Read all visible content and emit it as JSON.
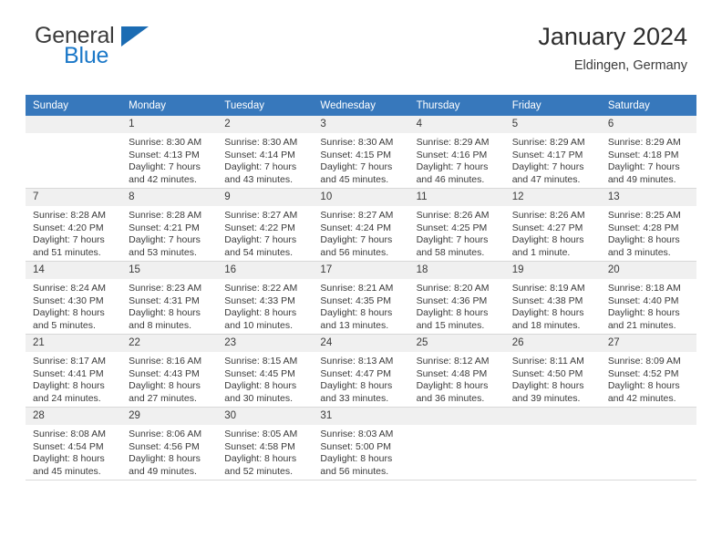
{
  "brand": {
    "name_part1": "General",
    "name_part2": "Blue"
  },
  "header": {
    "title": "January 2024",
    "subtitle": "Eldingen, Germany"
  },
  "colors": {
    "header_blue": "#3778bc",
    "logo_blue": "#1b78c8",
    "daynum_bg": "#f0f0f0",
    "grid_line": "#d8d8d8",
    "text": "#3a3a3a"
  },
  "weekdays": [
    "Sunday",
    "Monday",
    "Tuesday",
    "Wednesday",
    "Thursday",
    "Friday",
    "Saturday"
  ],
  "weeks": [
    [
      {
        "day": "",
        "empty": true,
        "sunrise": "",
        "sunset": "",
        "daylight1": "",
        "daylight2": ""
      },
      {
        "day": "1",
        "sunrise": "Sunrise: 8:30 AM",
        "sunset": "Sunset: 4:13 PM",
        "daylight1": "Daylight: 7 hours",
        "daylight2": "and 42 minutes."
      },
      {
        "day": "2",
        "sunrise": "Sunrise: 8:30 AM",
        "sunset": "Sunset: 4:14 PM",
        "daylight1": "Daylight: 7 hours",
        "daylight2": "and 43 minutes."
      },
      {
        "day": "3",
        "sunrise": "Sunrise: 8:30 AM",
        "sunset": "Sunset: 4:15 PM",
        "daylight1": "Daylight: 7 hours",
        "daylight2": "and 45 minutes."
      },
      {
        "day": "4",
        "sunrise": "Sunrise: 8:29 AM",
        "sunset": "Sunset: 4:16 PM",
        "daylight1": "Daylight: 7 hours",
        "daylight2": "and 46 minutes."
      },
      {
        "day": "5",
        "sunrise": "Sunrise: 8:29 AM",
        "sunset": "Sunset: 4:17 PM",
        "daylight1": "Daylight: 7 hours",
        "daylight2": "and 47 minutes."
      },
      {
        "day": "6",
        "sunrise": "Sunrise: 8:29 AM",
        "sunset": "Sunset: 4:18 PM",
        "daylight1": "Daylight: 7 hours",
        "daylight2": "and 49 minutes."
      }
    ],
    [
      {
        "day": "7",
        "sunrise": "Sunrise: 8:28 AM",
        "sunset": "Sunset: 4:20 PM",
        "daylight1": "Daylight: 7 hours",
        "daylight2": "and 51 minutes."
      },
      {
        "day": "8",
        "sunrise": "Sunrise: 8:28 AM",
        "sunset": "Sunset: 4:21 PM",
        "daylight1": "Daylight: 7 hours",
        "daylight2": "and 53 minutes."
      },
      {
        "day": "9",
        "sunrise": "Sunrise: 8:27 AM",
        "sunset": "Sunset: 4:22 PM",
        "daylight1": "Daylight: 7 hours",
        "daylight2": "and 54 minutes."
      },
      {
        "day": "10",
        "sunrise": "Sunrise: 8:27 AM",
        "sunset": "Sunset: 4:24 PM",
        "daylight1": "Daylight: 7 hours",
        "daylight2": "and 56 minutes."
      },
      {
        "day": "11",
        "sunrise": "Sunrise: 8:26 AM",
        "sunset": "Sunset: 4:25 PM",
        "daylight1": "Daylight: 7 hours",
        "daylight2": "and 58 minutes."
      },
      {
        "day": "12",
        "sunrise": "Sunrise: 8:26 AM",
        "sunset": "Sunset: 4:27 PM",
        "daylight1": "Daylight: 8 hours",
        "daylight2": "and 1 minute."
      },
      {
        "day": "13",
        "sunrise": "Sunrise: 8:25 AM",
        "sunset": "Sunset: 4:28 PM",
        "daylight1": "Daylight: 8 hours",
        "daylight2": "and 3 minutes."
      }
    ],
    [
      {
        "day": "14",
        "sunrise": "Sunrise: 8:24 AM",
        "sunset": "Sunset: 4:30 PM",
        "daylight1": "Daylight: 8 hours",
        "daylight2": "and 5 minutes."
      },
      {
        "day": "15",
        "sunrise": "Sunrise: 8:23 AM",
        "sunset": "Sunset: 4:31 PM",
        "daylight1": "Daylight: 8 hours",
        "daylight2": "and 8 minutes."
      },
      {
        "day": "16",
        "sunrise": "Sunrise: 8:22 AM",
        "sunset": "Sunset: 4:33 PM",
        "daylight1": "Daylight: 8 hours",
        "daylight2": "and 10 minutes."
      },
      {
        "day": "17",
        "sunrise": "Sunrise: 8:21 AM",
        "sunset": "Sunset: 4:35 PM",
        "daylight1": "Daylight: 8 hours",
        "daylight2": "and 13 minutes."
      },
      {
        "day": "18",
        "sunrise": "Sunrise: 8:20 AM",
        "sunset": "Sunset: 4:36 PM",
        "daylight1": "Daylight: 8 hours",
        "daylight2": "and 15 minutes."
      },
      {
        "day": "19",
        "sunrise": "Sunrise: 8:19 AM",
        "sunset": "Sunset: 4:38 PM",
        "daylight1": "Daylight: 8 hours",
        "daylight2": "and 18 minutes."
      },
      {
        "day": "20",
        "sunrise": "Sunrise: 8:18 AM",
        "sunset": "Sunset: 4:40 PM",
        "daylight1": "Daylight: 8 hours",
        "daylight2": "and 21 minutes."
      }
    ],
    [
      {
        "day": "21",
        "sunrise": "Sunrise: 8:17 AM",
        "sunset": "Sunset: 4:41 PM",
        "daylight1": "Daylight: 8 hours",
        "daylight2": "and 24 minutes."
      },
      {
        "day": "22",
        "sunrise": "Sunrise: 8:16 AM",
        "sunset": "Sunset: 4:43 PM",
        "daylight1": "Daylight: 8 hours",
        "daylight2": "and 27 minutes."
      },
      {
        "day": "23",
        "sunrise": "Sunrise: 8:15 AM",
        "sunset": "Sunset: 4:45 PM",
        "daylight1": "Daylight: 8 hours",
        "daylight2": "and 30 minutes."
      },
      {
        "day": "24",
        "sunrise": "Sunrise: 8:13 AM",
        "sunset": "Sunset: 4:47 PM",
        "daylight1": "Daylight: 8 hours",
        "daylight2": "and 33 minutes."
      },
      {
        "day": "25",
        "sunrise": "Sunrise: 8:12 AM",
        "sunset": "Sunset: 4:48 PM",
        "daylight1": "Daylight: 8 hours",
        "daylight2": "and 36 minutes."
      },
      {
        "day": "26",
        "sunrise": "Sunrise: 8:11 AM",
        "sunset": "Sunset: 4:50 PM",
        "daylight1": "Daylight: 8 hours",
        "daylight2": "and 39 minutes."
      },
      {
        "day": "27",
        "sunrise": "Sunrise: 8:09 AM",
        "sunset": "Sunset: 4:52 PM",
        "daylight1": "Daylight: 8 hours",
        "daylight2": "and 42 minutes."
      }
    ],
    [
      {
        "day": "28",
        "sunrise": "Sunrise: 8:08 AM",
        "sunset": "Sunset: 4:54 PM",
        "daylight1": "Daylight: 8 hours",
        "daylight2": "and 45 minutes."
      },
      {
        "day": "29",
        "sunrise": "Sunrise: 8:06 AM",
        "sunset": "Sunset: 4:56 PM",
        "daylight1": "Daylight: 8 hours",
        "daylight2": "and 49 minutes."
      },
      {
        "day": "30",
        "sunrise": "Sunrise: 8:05 AM",
        "sunset": "Sunset: 4:58 PM",
        "daylight1": "Daylight: 8 hours",
        "daylight2": "and 52 minutes."
      },
      {
        "day": "31",
        "sunrise": "Sunrise: 8:03 AM",
        "sunset": "Sunset: 5:00 PM",
        "daylight1": "Daylight: 8 hours",
        "daylight2": "and 56 minutes."
      },
      {
        "day": "",
        "empty": true,
        "sunrise": "",
        "sunset": "",
        "daylight1": "",
        "daylight2": ""
      },
      {
        "day": "",
        "empty": true,
        "sunrise": "",
        "sunset": "",
        "daylight1": "",
        "daylight2": ""
      },
      {
        "day": "",
        "empty": true,
        "sunrise": "",
        "sunset": "",
        "daylight1": "",
        "daylight2": ""
      }
    ]
  ]
}
